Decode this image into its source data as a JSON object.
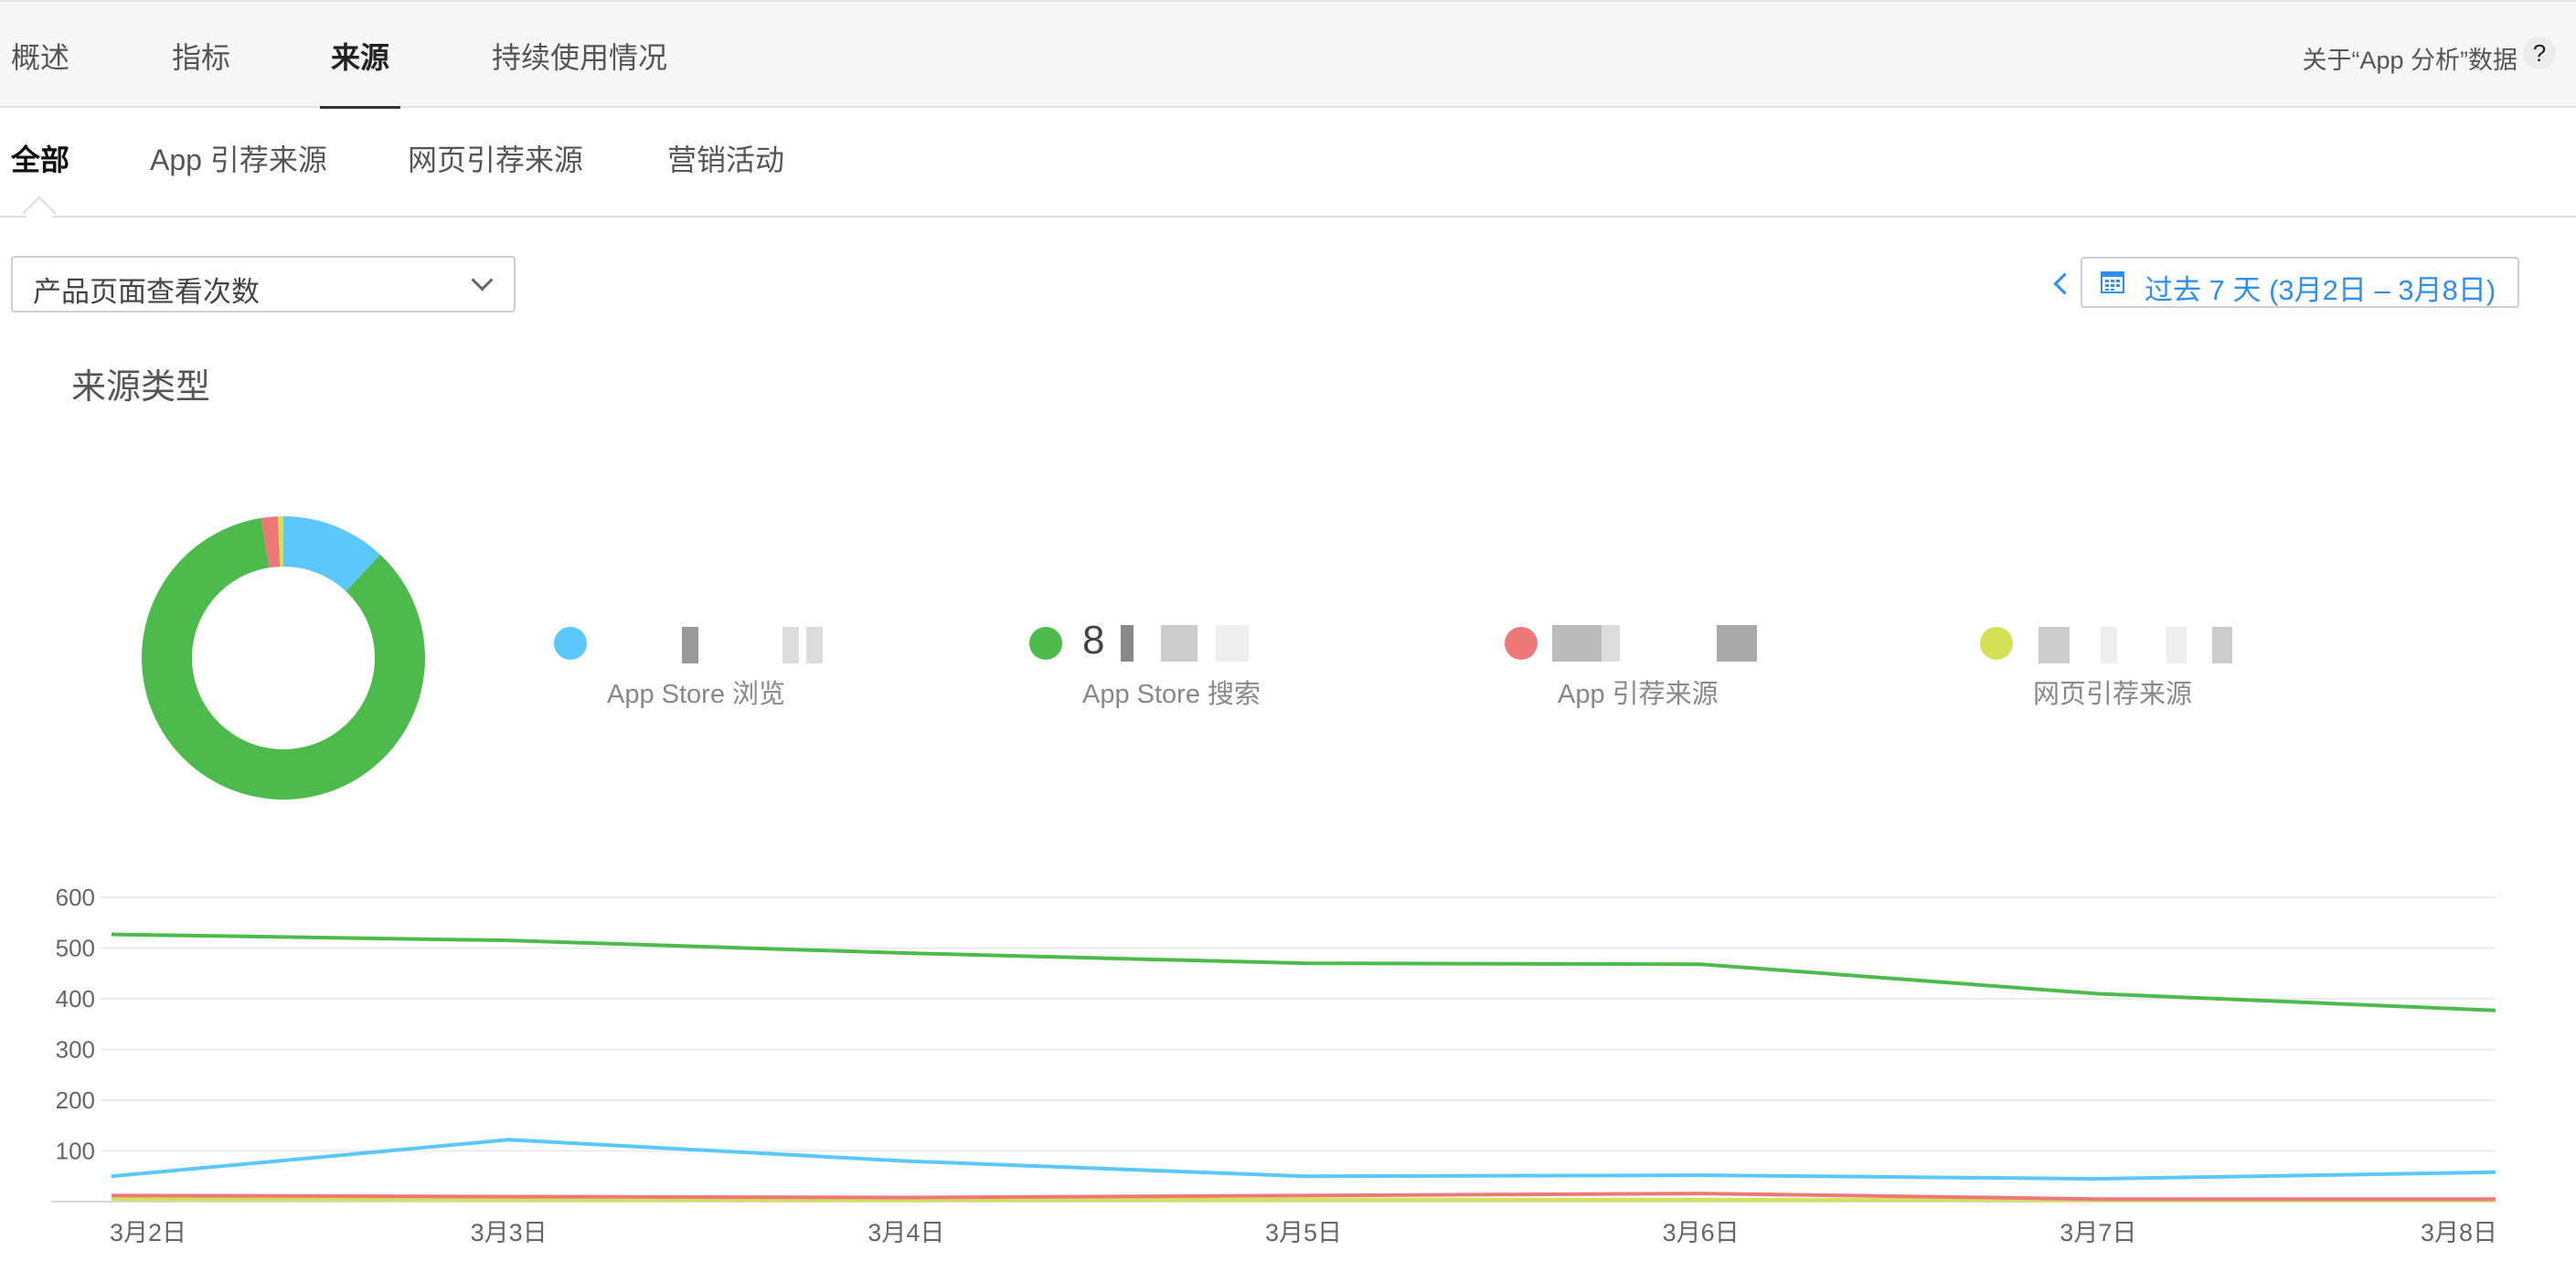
{
  "top_tabs": [
    {
      "label": "概述"
    },
    {
      "label": "指标"
    },
    {
      "label": "来源"
    },
    {
      "label": "持续使用情况"
    }
  ],
  "about_link": "关于“App 分析”数据",
  "help_label": "?",
  "sub_tabs": [
    {
      "label": "全部"
    },
    {
      "label": "App 引荐来源"
    },
    {
      "label": "网页引荐来源"
    },
    {
      "label": "营销活动"
    }
  ],
  "metric_select": {
    "value": "产品页面查看次数"
  },
  "date_range": {
    "label": "过去 7 天 (3月2日 – 3月8日)"
  },
  "section_title": "来源类型",
  "legend": [
    {
      "label": "App Store 浏览",
      "value": "",
      "color": "#5ac8fa"
    },
    {
      "label": "App Store 搜索",
      "value": "8",
      "color": "#4cbb4c"
    },
    {
      "label": "App 引荐来源",
      "value": "",
      "color": "#ee7878"
    },
    {
      "label": "网页引荐来源",
      "value": "",
      "color": "#d4e157"
    }
  ],
  "chart_data": [
    {
      "type": "pie",
      "title": "来源类型",
      "labels": [
        "App Store 浏览",
        "App Store 搜索",
        "App 引荐来源",
        "网页引荐来源"
      ],
      "values": [
        12,
        85.5,
        1.9,
        0.6
      ],
      "colors": [
        "#5ac8fa",
        "#4cbb4c",
        "#ee7878",
        "#d4e157"
      ]
    },
    {
      "type": "line",
      "x": [
        "3月2日",
        "3月3日",
        "3月4日",
        "3月5日",
        "3月6日",
        "3月7日",
        "3月8日"
      ],
      "ylim": [
        0,
        600
      ],
      "yticks": [
        100,
        200,
        300,
        400,
        500,
        600
      ],
      "grid": true,
      "series": [
        {
          "name": "App Store 搜索",
          "color": "#4cbb4c",
          "values": [
            527,
            515,
            490,
            470,
            468,
            410,
            377
          ]
        },
        {
          "name": "App Store 浏览",
          "color": "#5ac8fa",
          "values": [
            50,
            122,
            80,
            50,
            52,
            45,
            58
          ]
        },
        {
          "name": "App 引荐来源",
          "color": "#ee7878",
          "values": [
            12,
            10,
            8,
            12,
            16,
            5,
            5
          ]
        },
        {
          "name": "网页引荐来源",
          "color": "#d4e157",
          "values": [
            5,
            4,
            3,
            4,
            4,
            3,
            3
          ]
        }
      ]
    }
  ]
}
